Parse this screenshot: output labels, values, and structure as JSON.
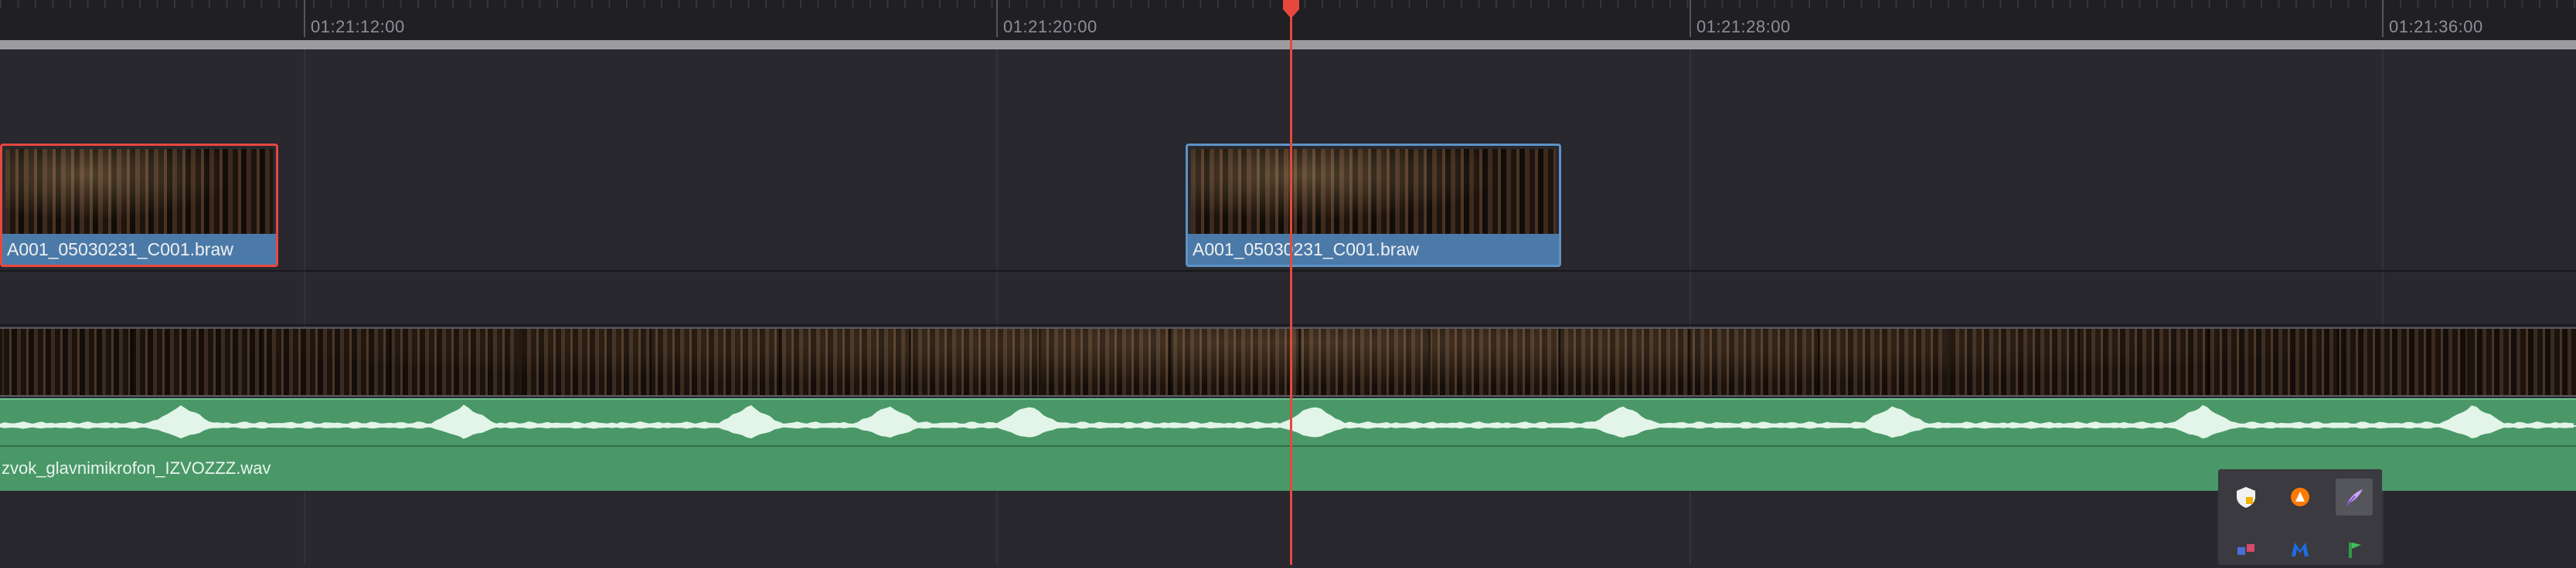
{
  "ruler": {
    "timecodes": [
      "01:21:12:00",
      "01:21:20:00",
      "01:21:28:00",
      "01:21:36:00"
    ]
  },
  "video_track_2": {
    "clips": [
      {
        "name": "A001_05030231_C001.braw",
        "selected": true
      },
      {
        "name": "A001_05030231_C001.braw",
        "selected": false
      }
    ]
  },
  "audio_track": {
    "clip_name": "zvok_glavnimikrofon_IZVOZZZ.wav"
  },
  "colors": {
    "playhead": "#e8483c",
    "clip_name_bar": "#4b7aa8",
    "audio_clip": "#4a9868",
    "selected_outline": "#e8483c"
  },
  "system_tray": {
    "icons": [
      "security-shield-icon",
      "avast-icon",
      "feather-icon",
      "network-icon",
      "malwarebytes-icon",
      "green-flag-icon"
    ]
  }
}
